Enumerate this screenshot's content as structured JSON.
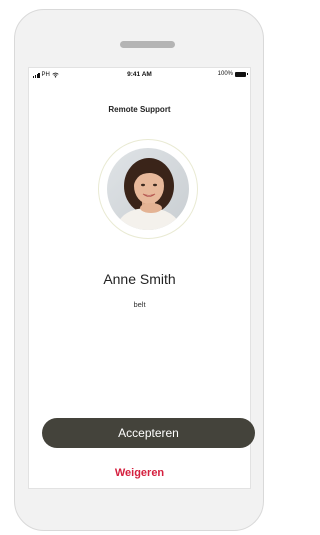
{
  "status_bar": {
    "carrier": "PH",
    "time": "9:41 AM",
    "battery": "100%",
    "icons": [
      "signal-icon",
      "wifi-icon",
      "battery-icon"
    ]
  },
  "screen": {
    "title": "Remote Support",
    "caller_name": "Anne Smith",
    "call_status": "belt"
  },
  "actions": {
    "accept_label": "Accepteren",
    "decline_label": "Weigeren"
  },
  "colors": {
    "accept_bg": "#44433b",
    "decline_text": "#d5203f",
    "ring": "#e9ead3",
    "phone_frame": "#f2f2f2"
  }
}
